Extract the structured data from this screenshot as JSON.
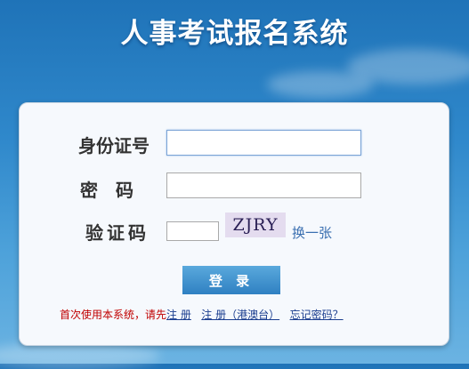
{
  "title": "人事考试报名系统",
  "form": {
    "id_label": "身份证号",
    "id_value": "",
    "password_label": "密　码",
    "password_value": "",
    "captcha_label": "验证码",
    "captcha_value": "",
    "captcha_text": "ZJRY",
    "refresh_label": "换一张",
    "login_label": "登 录"
  },
  "footer": {
    "note": "首次使用本系统，请先",
    "register": "注 册",
    "register_hk": "注 册（港澳台）",
    "forgot": "忘记密码？"
  },
  "colors": {
    "background": "#2f88cb",
    "panel": "#f6f9fd",
    "button": "#2f80c2",
    "note": "#c00000",
    "link": "#1a3d8f"
  }
}
